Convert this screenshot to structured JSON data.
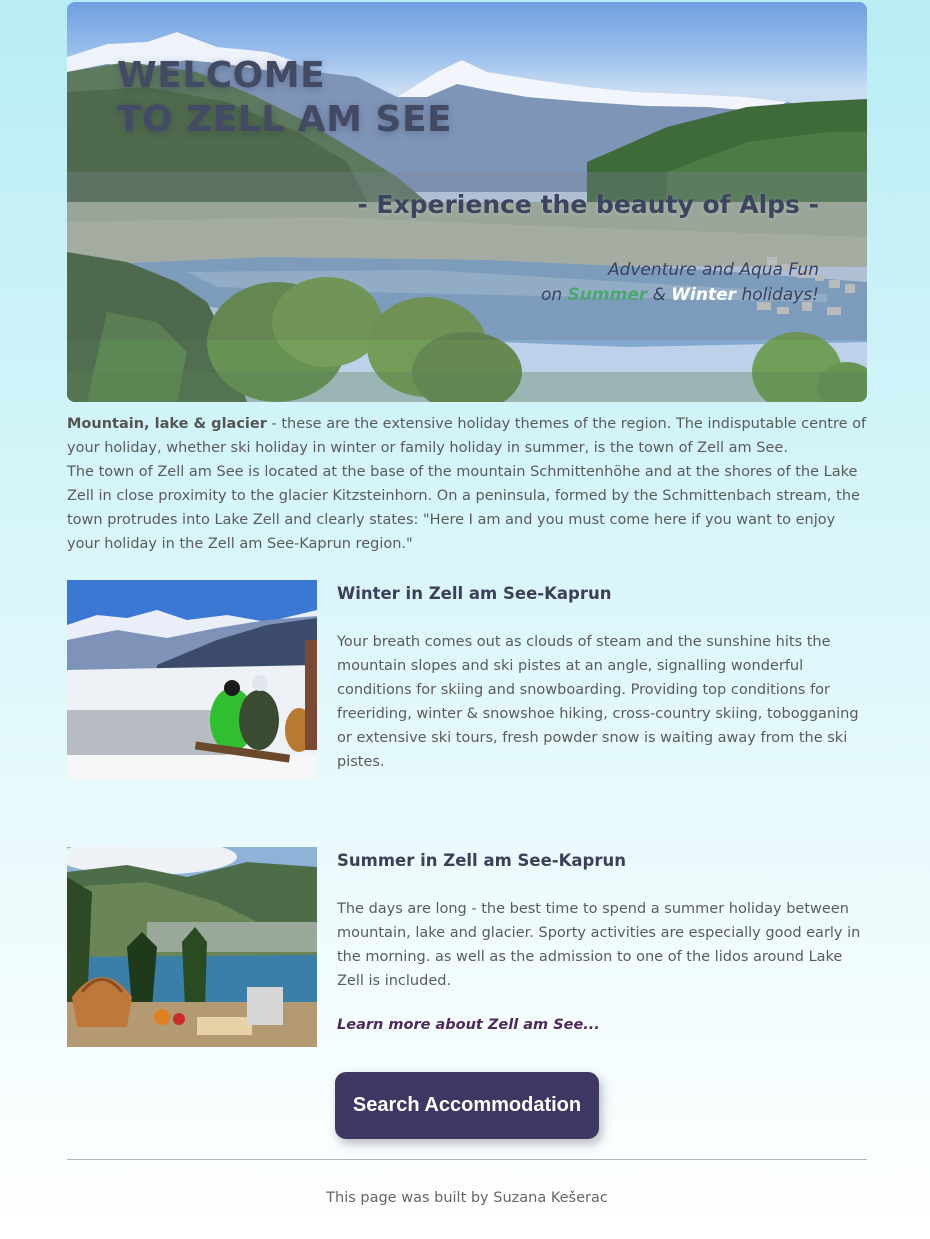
{
  "hero": {
    "title_line1": "WELCOME",
    "title_line2": "TO ZELL AM SEE",
    "subtitle": "- Experience the beauty of Alps -",
    "tagline_line1": "Adventure and Aqua Fun",
    "tagline_on": "on",
    "tagline_summer": "Summer",
    "tagline_amp": "&",
    "tagline_winter": "Winter",
    "tagline_end": "holidays!"
  },
  "intro": {
    "bold_lead": "Mountain, lake & glacier",
    "text_1": " - these are the extensive holiday themes of the region. The indisputable centre of your holiday, whether ski holiday in winter or family holiday in summer, is the town of Zell am See.",
    "text_2": "The town of Zell am See is located at the base of the mountain Schmittenhöhe and at the shores of the Lake Zell in close proximity to the glacier Kitzsteinhorn. On a peninsula, formed by the Schmittenbach stream, the town protrudes into Lake Zell and clearly states: \"Here I am and you must come here if you want to enjoy your holiday in the Zell am See-Kaprun region.\""
  },
  "winter": {
    "heading": "Winter in Zell am See-Kaprun",
    "body": "Your breath comes out as clouds of steam and the sunshine hits the mountain slopes and ski pistes at an angle, signalling wonderful conditions for skiing and snowboarding. Providing top conditions for freeriding, winter & snowshoe hiking, cross-country skiing, tobogganing or extensive ski tours, fresh powder snow is waiting away from the ski pistes."
  },
  "summer": {
    "heading": "Summer in Zell am See-Kaprun",
    "body": "The days are long - the best time to spend a summer holiday between mountain, lake and glacier. Sporty activities are especially good early in the morning. as well as the admission to one of the lidos around Lake Zell is included.",
    "learn_more": "Learn more about Zell am See..."
  },
  "cta": {
    "label": "Search Accommodation"
  },
  "footer": {
    "text": "This page was built by Suzana Kešerac"
  },
  "colors": {
    "button": "#3f3763",
    "summer_accent": "#4aa86a",
    "heading": "#3d3f58",
    "link": "#4e2a5a"
  }
}
